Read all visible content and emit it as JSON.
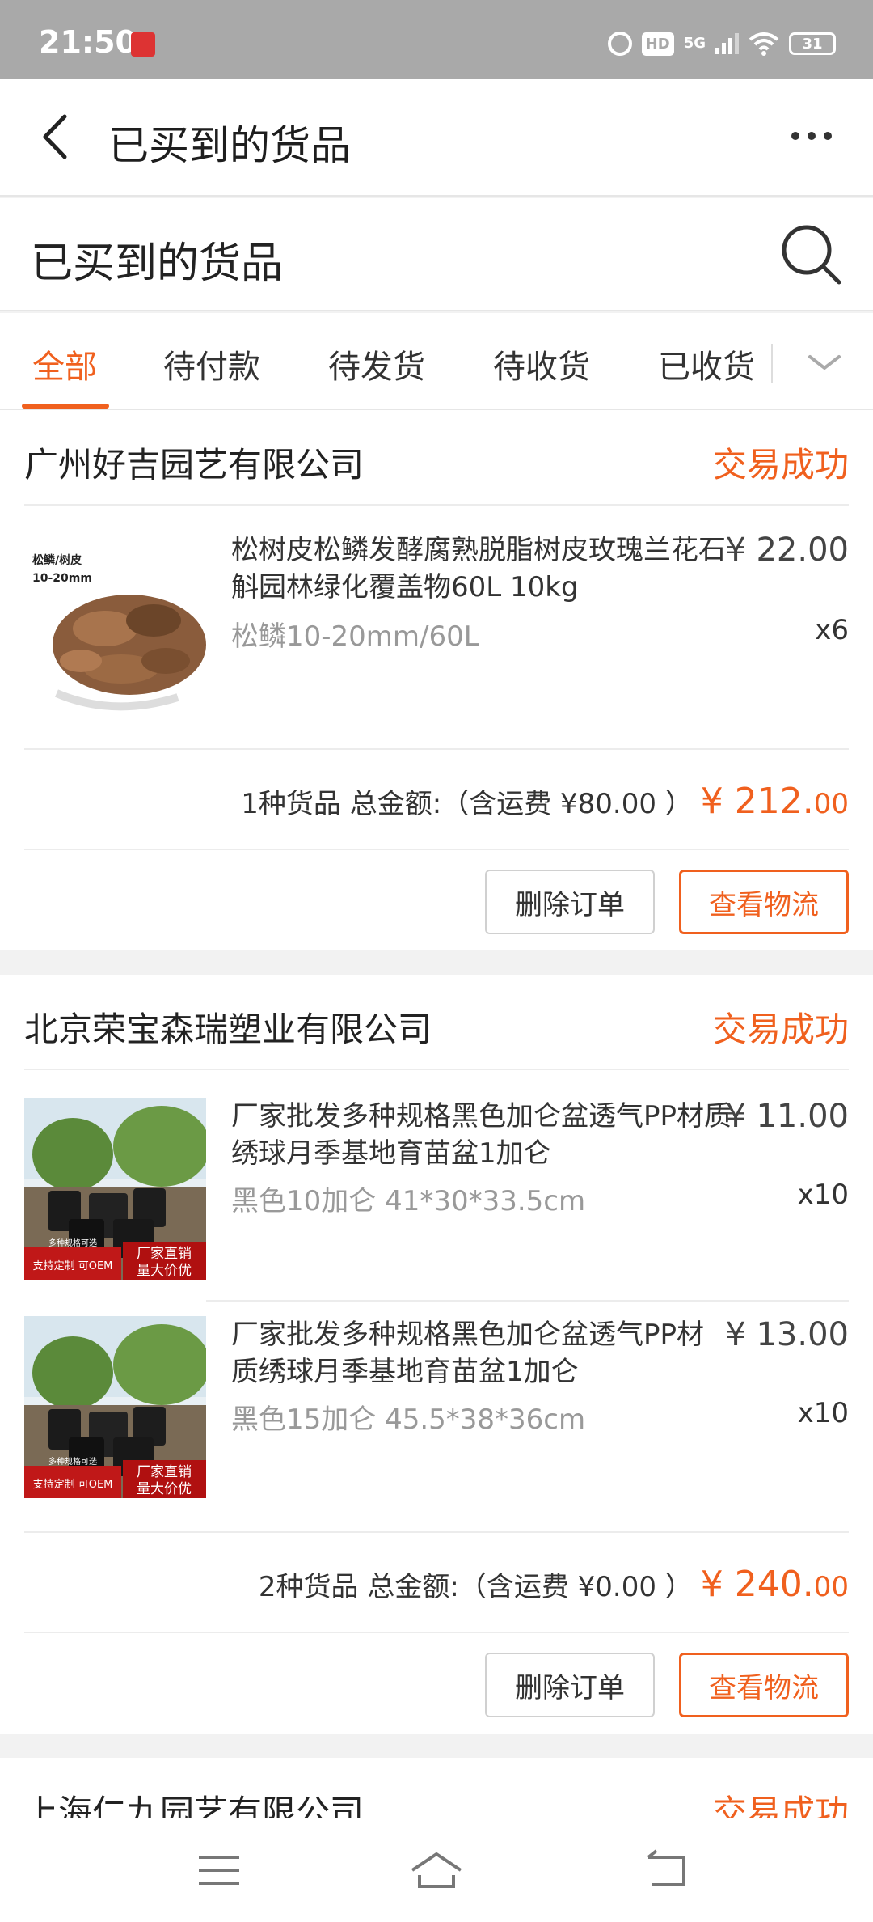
{
  "status_bar": {
    "time": "21:50",
    "hd": "HD",
    "network": "5G",
    "battery": "31"
  },
  "header": {
    "title": "已买到的货品"
  },
  "search": {
    "title": "已买到的货品"
  },
  "tabs": [
    {
      "label": "全部",
      "active": true
    },
    {
      "label": "待付款"
    },
    {
      "label": "待发货"
    },
    {
      "label": "待收货"
    },
    {
      "label": "已收货"
    }
  ],
  "orders": [
    {
      "shop": "广州好吉园艺有限公司",
      "status": "交易成功",
      "items": [
        {
          "thumb_label_1": "松鳞/树皮",
          "thumb_label_2": "10-20mm",
          "title": "松树皮松鳞发酵腐熟脱脂树皮玫瑰兰花石斛园林绿化覆盖物60L 10kg",
          "spec": "松鳞10-20mm/60L",
          "price": "¥ 22.00",
          "qty": "x6"
        }
      ],
      "summary": "1种货品 总金额:（含运费 ¥80.00 ）",
      "total_main": "¥ 212.",
      "total_cents": "00",
      "delete_label": "删除订单",
      "logistics_label": "查看物流"
    },
    {
      "shop": "北京荣宝森瑞塑业有限公司",
      "status": "交易成功",
      "items": [
        {
          "thumb_label_1": "厂家直销",
          "thumb_label_2": "量大价优",
          "thumb_label_3": "支持定制 可OEM",
          "thumb_label_4": "多种规格可选",
          "title": "厂家批发多种规格黑色加仑盆透气PP材质绣球月季基地育苗盆1加仑",
          "spec": "黑色10加仑 41*30*33.5cm",
          "price": "¥ 11.00",
          "qty": "x10"
        },
        {
          "thumb_label_1": "厂家直销",
          "thumb_label_2": "量大价优",
          "thumb_label_3": "支持定制 可OEM",
          "thumb_label_4": "多种规格可选",
          "title": "厂家批发多种规格黑色加仑盆透气PP材质绣球月季基地育苗盆1加仑",
          "spec": "黑色15加仑 45.5*38*36cm",
          "price": "¥ 13.00",
          "qty": "x10"
        }
      ],
      "summary": "2种货品 总金额:（含运费 ¥0.00 ）",
      "total_main": "¥ 240.",
      "total_cents": "00",
      "delete_label": "删除订单",
      "logistics_label": "查看物流"
    },
    {
      "shop": "上海仁九园艺有限公司",
      "status": "交易成功"
    }
  ]
}
